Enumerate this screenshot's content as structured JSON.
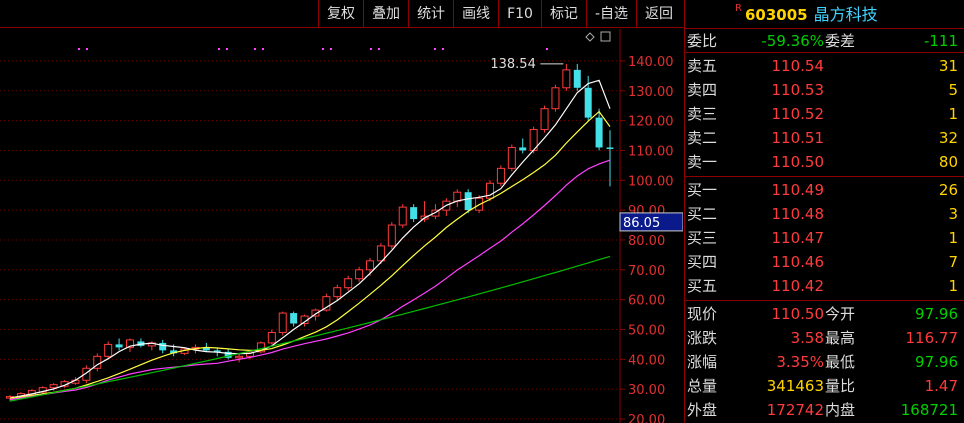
{
  "toolbar": {
    "buttons": [
      "复权",
      "叠加",
      "统计",
      "画线",
      "F10",
      "标记",
      "-自选",
      "返回"
    ]
  },
  "stock": {
    "badge": "R",
    "code": "603005",
    "name": "晶方科技"
  },
  "weibi": {
    "label": "委比",
    "value": "-59.36%",
    "label2": "委差",
    "value2": "-111"
  },
  "sells": [
    {
      "label": "卖五",
      "price": "110.54",
      "vol": "31"
    },
    {
      "label": "卖四",
      "price": "110.53",
      "vol": "5"
    },
    {
      "label": "卖三",
      "price": "110.52",
      "vol": "1"
    },
    {
      "label": "卖二",
      "price": "110.51",
      "vol": "32"
    },
    {
      "label": "卖一",
      "price": "110.50",
      "vol": "80"
    }
  ],
  "buys": [
    {
      "label": "买一",
      "price": "110.49",
      "vol": "26"
    },
    {
      "label": "买二",
      "price": "110.48",
      "vol": "3"
    },
    {
      "label": "买三",
      "price": "110.47",
      "vol": "1"
    },
    {
      "label": "买四",
      "price": "110.46",
      "vol": "7"
    },
    {
      "label": "买五",
      "price": "110.42",
      "vol": "1"
    }
  ],
  "quote": [
    {
      "l1": "现价",
      "v1": "110.50",
      "l2": "今开",
      "v2": "97.96",
      "c1": "red",
      "c2": "green"
    },
    {
      "l1": "涨跌",
      "v1": "3.58",
      "l2": "最高",
      "v2": "116.77",
      "c1": "red",
      "c2": "red"
    },
    {
      "l1": "涨幅",
      "v1": "3.35%",
      "l2": "最低",
      "v2": "97.96",
      "c1": "red",
      "c2": "green"
    },
    {
      "l1": "总量",
      "v1": "341463",
      "l2": "量比",
      "v2": "1.47",
      "c1": "yellow",
      "c2": "red"
    },
    {
      "l1": "外盘",
      "v1": "172742",
      "l2": "内盘",
      "v2": "168721",
      "c1": "red",
      "c2": "green"
    }
  ],
  "chart_data": {
    "type": "candlestick",
    "ylim": [
      20,
      145
    ],
    "yticks": [
      "140.00",
      "130.00",
      "120.00",
      "110.00",
      "100.00",
      "90.00",
      "80.00",
      "70.00",
      "60.00",
      "50.00",
      "40.00",
      "30.00",
      "20.00"
    ],
    "crosshair_price": "86.05",
    "annotation": "138.54",
    "colors": {
      "up": "#ff3b3b",
      "down": "#44e0e8",
      "ma5": "#ffffff",
      "ma10": "#ffff40",
      "ma20": "#ff40ff",
      "ma60": "#00c000",
      "axis": "#8b0000"
    },
    "candles": [
      [
        27,
        28,
        26,
        27.5
      ],
      [
        27.5,
        29,
        27,
        28.5
      ],
      [
        28,
        30,
        27.5,
        29.5
      ],
      [
        29,
        31,
        28.5,
        30.5
      ],
      [
        30.5,
        32,
        29.5,
        31.5
      ],
      [
        31,
        33,
        30.5,
        32.5
      ],
      [
        32,
        34,
        31.5,
        33
      ],
      [
        33,
        38,
        32,
        37
      ],
      [
        37,
        42,
        36,
        41
      ],
      [
        41,
        46,
        40,
        45
      ],
      [
        45,
        47,
        43,
        44
      ],
      [
        44,
        47,
        42.5,
        46.5
      ],
      [
        46,
        47,
        44,
        44.5
      ],
      [
        44.5,
        46,
        43,
        45.5
      ],
      [
        45.5,
        46.5,
        42,
        43
      ],
      [
        43,
        45,
        41,
        42
      ],
      [
        42,
        44,
        41.5,
        43.5
      ],
      [
        43.5,
        45,
        42,
        44
      ],
      [
        44,
        45.5,
        42.5,
        43
      ],
      [
        43,
        44,
        41,
        42.5
      ],
      [
        42.5,
        43.5,
        40,
        40.5
      ],
      [
        40.5,
        42,
        39,
        41
      ],
      [
        41,
        43,
        40,
        42.5
      ],
      [
        42.5,
        46,
        42,
        45.5
      ],
      [
        45.5,
        50,
        45,
        49
      ],
      [
        49,
        56,
        48,
        55.5
      ],
      [
        55.5,
        56,
        51,
        52
      ],
      [
        52,
        55,
        51,
        54.5
      ],
      [
        54.5,
        57,
        53,
        56.5
      ],
      [
        56.5,
        62,
        56,
        61
      ],
      [
        61,
        65,
        60,
        64
      ],
      [
        64,
        68,
        63,
        67
      ],
      [
        67,
        71,
        66,
        70
      ],
      [
        70,
        74,
        68,
        73
      ],
      [
        73,
        79,
        72,
        78
      ],
      [
        78,
        86,
        77,
        85
      ],
      [
        85,
        92,
        84,
        91
      ],
      [
        91,
        92,
        86,
        87
      ],
      [
        87,
        93,
        86,
        88
      ],
      [
        88,
        92,
        87,
        90
      ],
      [
        90,
        94,
        88,
        93
      ],
      [
        93,
        97,
        91,
        96
      ],
      [
        96,
        97,
        89,
        90
      ],
      [
        90,
        95,
        89,
        94
      ],
      [
        94,
        100,
        93,
        99
      ],
      [
        99,
        105,
        98,
        104
      ],
      [
        104,
        112,
        103,
        111
      ],
      [
        111,
        114,
        109,
        110
      ],
      [
        110,
        118,
        109,
        117
      ],
      [
        117,
        125,
        116,
        124
      ],
      [
        124,
        132,
        123,
        131
      ],
      [
        131,
        139,
        130,
        137
      ],
      [
        137,
        139,
        130,
        131
      ],
      [
        131,
        135,
        120,
        121
      ],
      [
        121,
        124,
        110,
        111
      ],
      [
        111,
        116.77,
        97.96,
        110.5
      ]
    ],
    "ma5": [
      27,
      27.7,
      28.4,
      29.2,
      30.1,
      31.3,
      33,
      35.4,
      38.2,
      40.2,
      42.6,
      44.4,
      45.1,
      45.4,
      44.7,
      44.3,
      43.9,
      43.1,
      42.6,
      42.4,
      42,
      41.9,
      42,
      43,
      44.5,
      47.2,
      50,
      52.5,
      55.2,
      57.4,
      59.7,
      62.5,
      65.3,
      68.8,
      72.5,
      76.5,
      80.7,
      84.3,
      87.4,
      89.2,
      91.6,
      93.1,
      93.8,
      94.3,
      95,
      97.2,
      101.8,
      106.1,
      110.1,
      114.2,
      118.6,
      124,
      129.4,
      132.4,
      133.5,
      124
    ],
    "ma10": [
      27,
      27.4,
      27.9,
      28.4,
      28.9,
      29.6,
      30.3,
      31.4,
      32.6,
      33.8,
      35.2,
      36.7,
      38.2,
      39.7,
      41,
      42.2,
      43,
      43.6,
      44,
      43.8,
      43.5,
      43.2,
      43,
      43,
      43.6,
      44.8,
      46.1,
      47.6,
      49.1,
      50.9,
      53.2,
      56,
      58.8,
      61.8,
      64.8,
      68,
      71.4,
      74.8,
      78,
      81,
      84.2,
      87,
      89.6,
      91.8,
      93.6,
      95.6,
      97.9,
      100.2,
      102.6,
      105.2,
      108.4,
      112.5,
      116.2,
      119.8,
      123,
      118
    ]
  }
}
